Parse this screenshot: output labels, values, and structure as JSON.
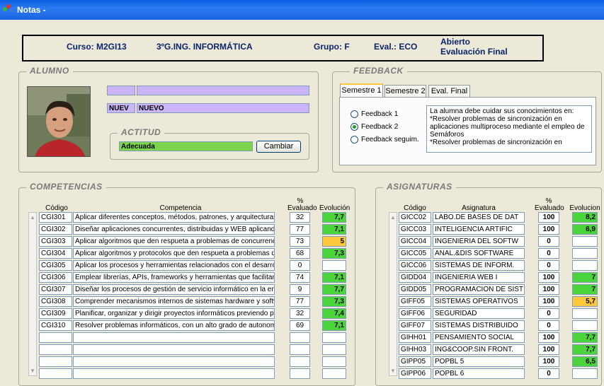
{
  "window": {
    "title": "Notas -"
  },
  "header": {
    "curso": "Curso: M2GI13",
    "titulacion": "3ºG.ING. INFORMÁTICA",
    "grupo": "Grupo: F",
    "eval": "Eval.: ECO",
    "estado": "Abierto",
    "tipo_eval": "Evaluación Final"
  },
  "alumno": {
    "group_title": "ALUMNO",
    "field1": "",
    "field2": "",
    "apellido_code": "NUEV",
    "apellido": "NUEVO",
    "actitud_title": "ACTITUD",
    "actitud_value": "Adecuada",
    "cambiar_label": "Cambiar"
  },
  "feedback": {
    "group_title": "FEEDBACK",
    "tabs": [
      "Semestre 1",
      "Semestre 2",
      "Eval. Final"
    ],
    "active_tab": 0,
    "options": [
      "Feedback 1",
      "Feedback 2",
      "Feedback seguim."
    ],
    "selected_option": 1,
    "text": "La alumna debe cuidar sus conocimientos en:\n*Resolver problemas de sincronización en aplicaciones multiproceso mediante el empleo de Semáforos\n*Resolver problemas de sincronización en"
  },
  "competencias": {
    "group_title": "COMPETENCIAS",
    "headers": {
      "codigo": "Código",
      "competencia": "Competencia",
      "pct": "%\nEvaluado",
      "evolucion": "Evolución"
    },
    "rows": [
      {
        "codigo": "CGI301",
        "competencia": "Aplicar diferentes conceptos, métodos, patrones, y arquitecturas",
        "pct": "32",
        "evol": "7,7",
        "color": "#4CD43C"
      },
      {
        "codigo": "CGI302",
        "competencia": "Diseñar aplicaciones concurrentes, distribuidas y WEB aplicando t",
        "pct": "77",
        "evol": "7,1",
        "color": "#4CD43C"
      },
      {
        "codigo": "CGI303",
        "competencia": "Aplicar algoritmos que den respueta a problemas de concurrencia",
        "pct": "73",
        "evol": "5",
        "color": "#FFC83C"
      },
      {
        "codigo": "CGI304",
        "competencia": "Aplicar algoritmos y protocolos que den respueta a problemas de",
        "pct": "68",
        "evol": "7,3",
        "color": "#4CD43C"
      },
      {
        "codigo": "CGI305",
        "competencia": "Aplicar los procesos y herramientas relacionados con el desarroll",
        "pct": "0",
        "evol": "",
        "color": "#FFFFFF"
      },
      {
        "codigo": "CGI306",
        "competencia": "Emplear librerías, APIs, frameworks y herramientas que facilitan y",
        "pct": "74",
        "evol": "7,1",
        "color": "#4CD43C"
      },
      {
        "codigo": "CGI307",
        "competencia": "Diseñar los procesos de gestión de servicio informático en la emp",
        "pct": "9",
        "evol": "7,7",
        "color": "#4CD43C"
      },
      {
        "codigo": "CGI308",
        "competencia": "Comprender mecanismos internos de sistemas hardware y softw",
        "pct": "77",
        "evol": "7,3",
        "color": "#4CD43C"
      },
      {
        "codigo": "CGI309",
        "competencia": "Planificar, organizar y dirigir proyectos informáticos previendo prc",
        "pct": "32",
        "evol": "7,4",
        "color": "#4CD43C"
      },
      {
        "codigo": "CGI310",
        "competencia": "Resolver problemas informáticos, con un alto grado de autonomía",
        "pct": "69",
        "evol": "7,1",
        "color": "#4CD43C"
      },
      {
        "codigo": "",
        "competencia": "",
        "pct": "",
        "evol": "",
        "color": "#FFFFFF"
      },
      {
        "codigo": "",
        "competencia": "",
        "pct": "",
        "evol": "",
        "color": "#FFFFFF"
      },
      {
        "codigo": "",
        "competencia": "",
        "pct": "",
        "evol": "",
        "color": "#FFFFFF"
      },
      {
        "codigo": "",
        "competencia": "",
        "pct": "",
        "evol": "",
        "color": "#FFFFFF"
      }
    ]
  },
  "asignaturas": {
    "group_title": "ASIGNATURAS",
    "headers": {
      "codigo": "Código",
      "asignatura": "Asignatura",
      "pct": "%\nEvaluado",
      "evolucion": "Evolucion"
    },
    "rows": [
      {
        "codigo": "GICC02",
        "asignatura": "LABO.DE BASES DE DAT",
        "pct": "100",
        "evol": "8,2",
        "color": "#4CD43C"
      },
      {
        "codigo": "GICC03",
        "asignatura": "INTELIGENCIA ARTIFIC",
        "pct": "100",
        "evol": "6,9",
        "color": "#4CD43C"
      },
      {
        "codigo": "GICC04",
        "asignatura": "INGENIERIA DEL SOFTW",
        "pct": "0",
        "evol": "",
        "color": "#FFFFFF"
      },
      {
        "codigo": "GICC05",
        "asignatura": "ANAL.&DIS SOFTWARE",
        "pct": "0",
        "evol": "",
        "color": "#FFFFFF"
      },
      {
        "codigo": "GICC06",
        "asignatura": "SISTEMAS DE INFORM.",
        "pct": "0",
        "evol": "",
        "color": "#FFFFFF"
      },
      {
        "codigo": "GIDD04",
        "asignatura": "INGENIERIA WEB I",
        "pct": "100",
        "evol": "7",
        "color": "#4CD43C"
      },
      {
        "codigo": "GIDD05",
        "asignatura": "PROGRAMACION DE SIST",
        "pct": "100",
        "evol": "7",
        "color": "#4CD43C"
      },
      {
        "codigo": "GIFF05",
        "asignatura": "SISTEMAS OPERATIVOS",
        "pct": "100",
        "evol": "5,7",
        "color": "#FFC83C"
      },
      {
        "codigo": "GIFF06",
        "asignatura": "SEGURIDAD",
        "pct": "0",
        "evol": "",
        "color": "#FFFFFF"
      },
      {
        "codigo": "GIFF07",
        "asignatura": "SISTEMAS DISTRIBUIDO",
        "pct": "0",
        "evol": "",
        "color": "#FFFFFF"
      },
      {
        "codigo": "GIHH01",
        "asignatura": "PENSAMIENTO SOCIAL",
        "pct": "100",
        "evol": "7,7",
        "color": "#4CD43C"
      },
      {
        "codigo": "GIHH03",
        "asignatura": "ING&COOP.SIN FRONT.",
        "pct": "100",
        "evol": "7,7",
        "color": "#4CD43C"
      },
      {
        "codigo": "GIPP05",
        "asignatura": "POPBL 5",
        "pct": "100",
        "evol": "6,5",
        "color": "#4CD43C"
      },
      {
        "codigo": "GIPP06",
        "asignatura": "POPBL 6",
        "pct": "0",
        "evol": "",
        "color": "#FFFFFF"
      }
    ]
  },
  "icons": {
    "app": "app-icon",
    "scroll_up": "scroll-up-icon",
    "scroll_down": "scroll-down-icon"
  }
}
